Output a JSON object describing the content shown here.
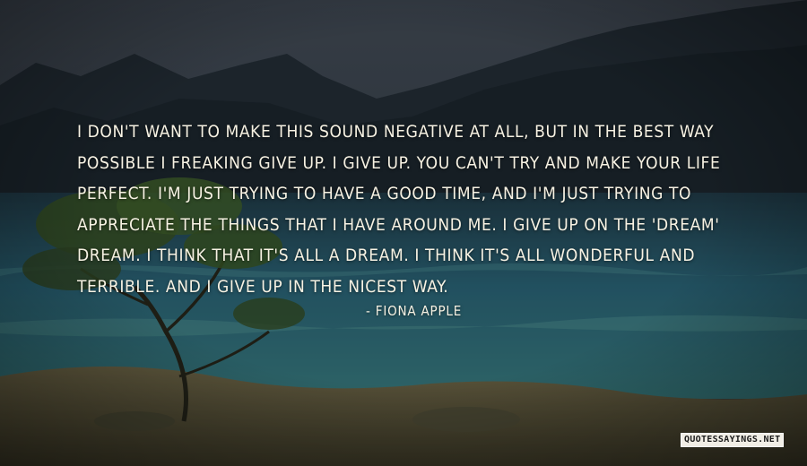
{
  "quote": {
    "text": "I don't want to make this sound negative at all, but in the best way\npossible I freaking give up. I give up. You can't try and make your life\nperfect. I'm just trying to have a good time, and I'm just trying to\nappreciate the things that I have around me. I give up on the 'dream'\ndream. I think that it's all a dream. I think it's all wonderful and\nterrible. And I give up in the nicest way.",
    "author": "- FIONA APPLE"
  },
  "watermark": "QUOTESSAYINGS.NET",
  "scene": {
    "description_icons": [
      "mountain-range-icon",
      "ocean-icon",
      "tree-icon",
      "rocky-shore-icon"
    ],
    "colors": {
      "sky": "#3a4552",
      "mountains": "#1f2a33",
      "sea": "#2f6f84",
      "shore": "#8a7a55",
      "text": "#f7f2e3"
    }
  }
}
